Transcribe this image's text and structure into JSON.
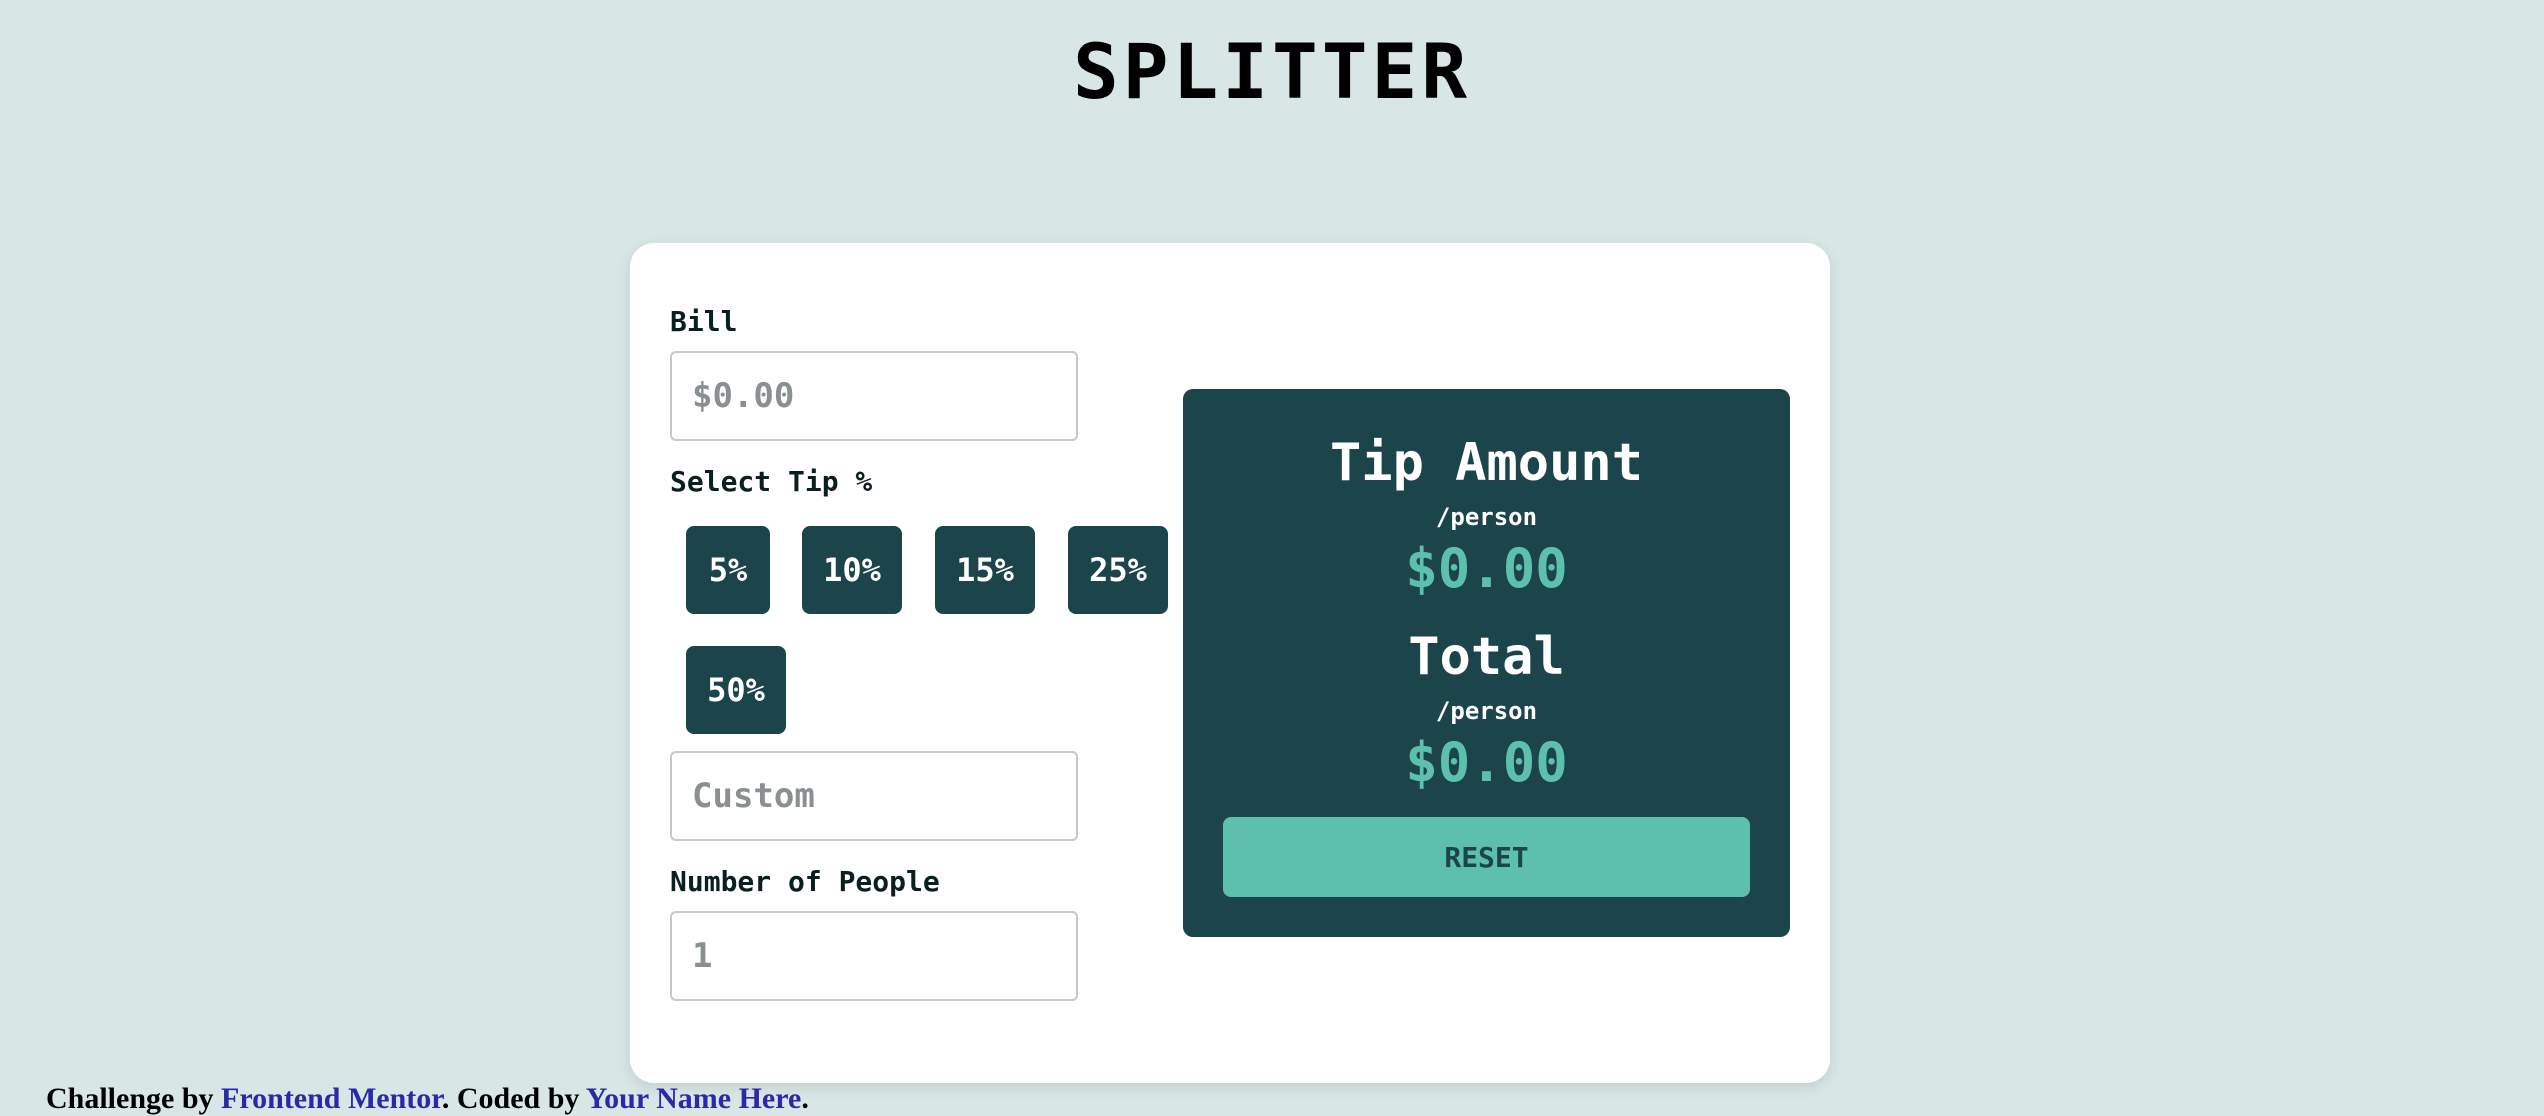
{
  "app": {
    "title": "SPLITTER"
  },
  "form": {
    "bill": {
      "label": "Bill",
      "placeholder": "$0.00",
      "value": ""
    },
    "tip": {
      "label": "Select Tip %",
      "options": [
        "5%",
        "10%",
        "15%",
        "25%",
        "50%"
      ],
      "custom_placeholder": "Custom"
    },
    "people": {
      "label": "Number of People",
      "placeholder": "1",
      "value": ""
    }
  },
  "results": {
    "tip_amount": {
      "label": "Tip Amount",
      "sub": "/person",
      "value": "$0.00"
    },
    "total": {
      "label": "Total",
      "sub": "/person",
      "value": "$0.00"
    },
    "reset_label": "RESET"
  },
  "attribution": {
    "text": "Challenge by",
    "link1": "Frontend Mentor",
    "middle": "Coded by",
    "link2": "Your Name Here"
  },
  "colors": {
    "background": "#d9e6e6",
    "card": "#ffffff",
    "panel": "#1c454b",
    "accent": "#5dc0ac",
    "field_border": "#c4c9cb"
  }
}
